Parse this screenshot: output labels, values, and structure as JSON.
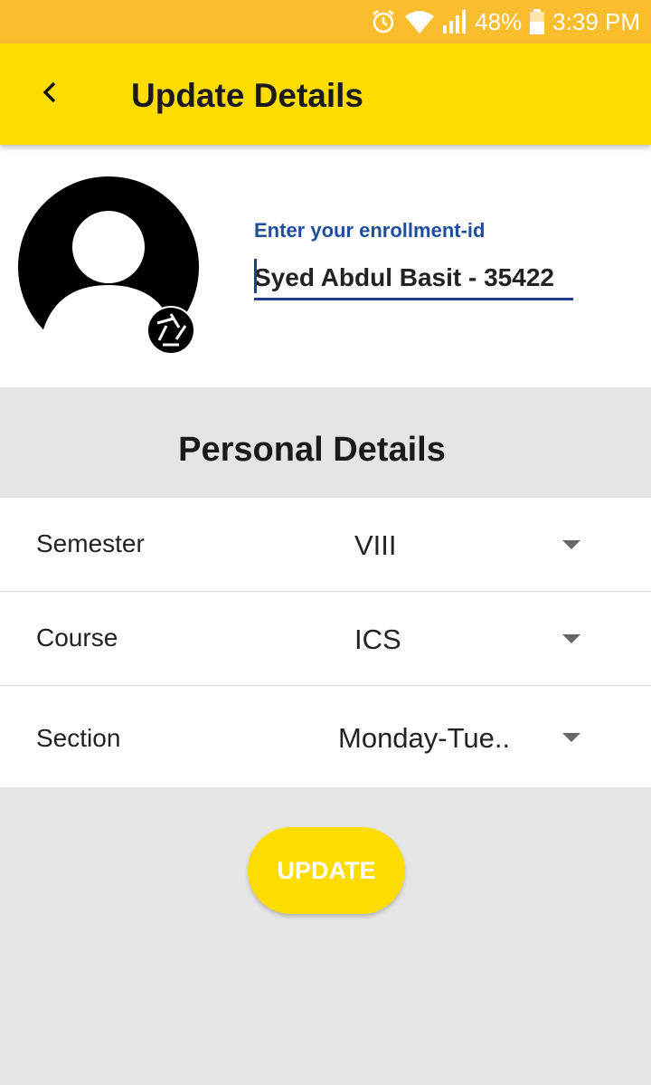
{
  "status_bar": {
    "battery": "48%",
    "time": "3:39 PM",
    "icons": [
      "alarm-icon",
      "wifi-icon",
      "signal-icon",
      "battery-icon"
    ]
  },
  "app_bar": {
    "title": "Update Details",
    "back_icon": "back-arrow-icon",
    "color": "#ffdc00"
  },
  "profile": {
    "avatar_icon": "person-icon",
    "camera_icon": "camera-shutter-icon",
    "enrollment_label": "Enter your enrollment-id",
    "enrollment_value": "Syed Abdul Basit - 35422"
  },
  "personal_details": {
    "title": "Personal Details",
    "rows": [
      {
        "label": "Semester",
        "value": "VIII"
      },
      {
        "label": "Course",
        "value": "ICS"
      },
      {
        "label": "Section",
        "value": "Monday-Tue.."
      }
    ]
  },
  "actions": {
    "update_label": "UPDATE"
  },
  "colors": {
    "status_bar": "#f9bd2d",
    "accent": "#ffdc00",
    "label_blue": "#1f4e9a",
    "background": "#e5e5e5"
  }
}
